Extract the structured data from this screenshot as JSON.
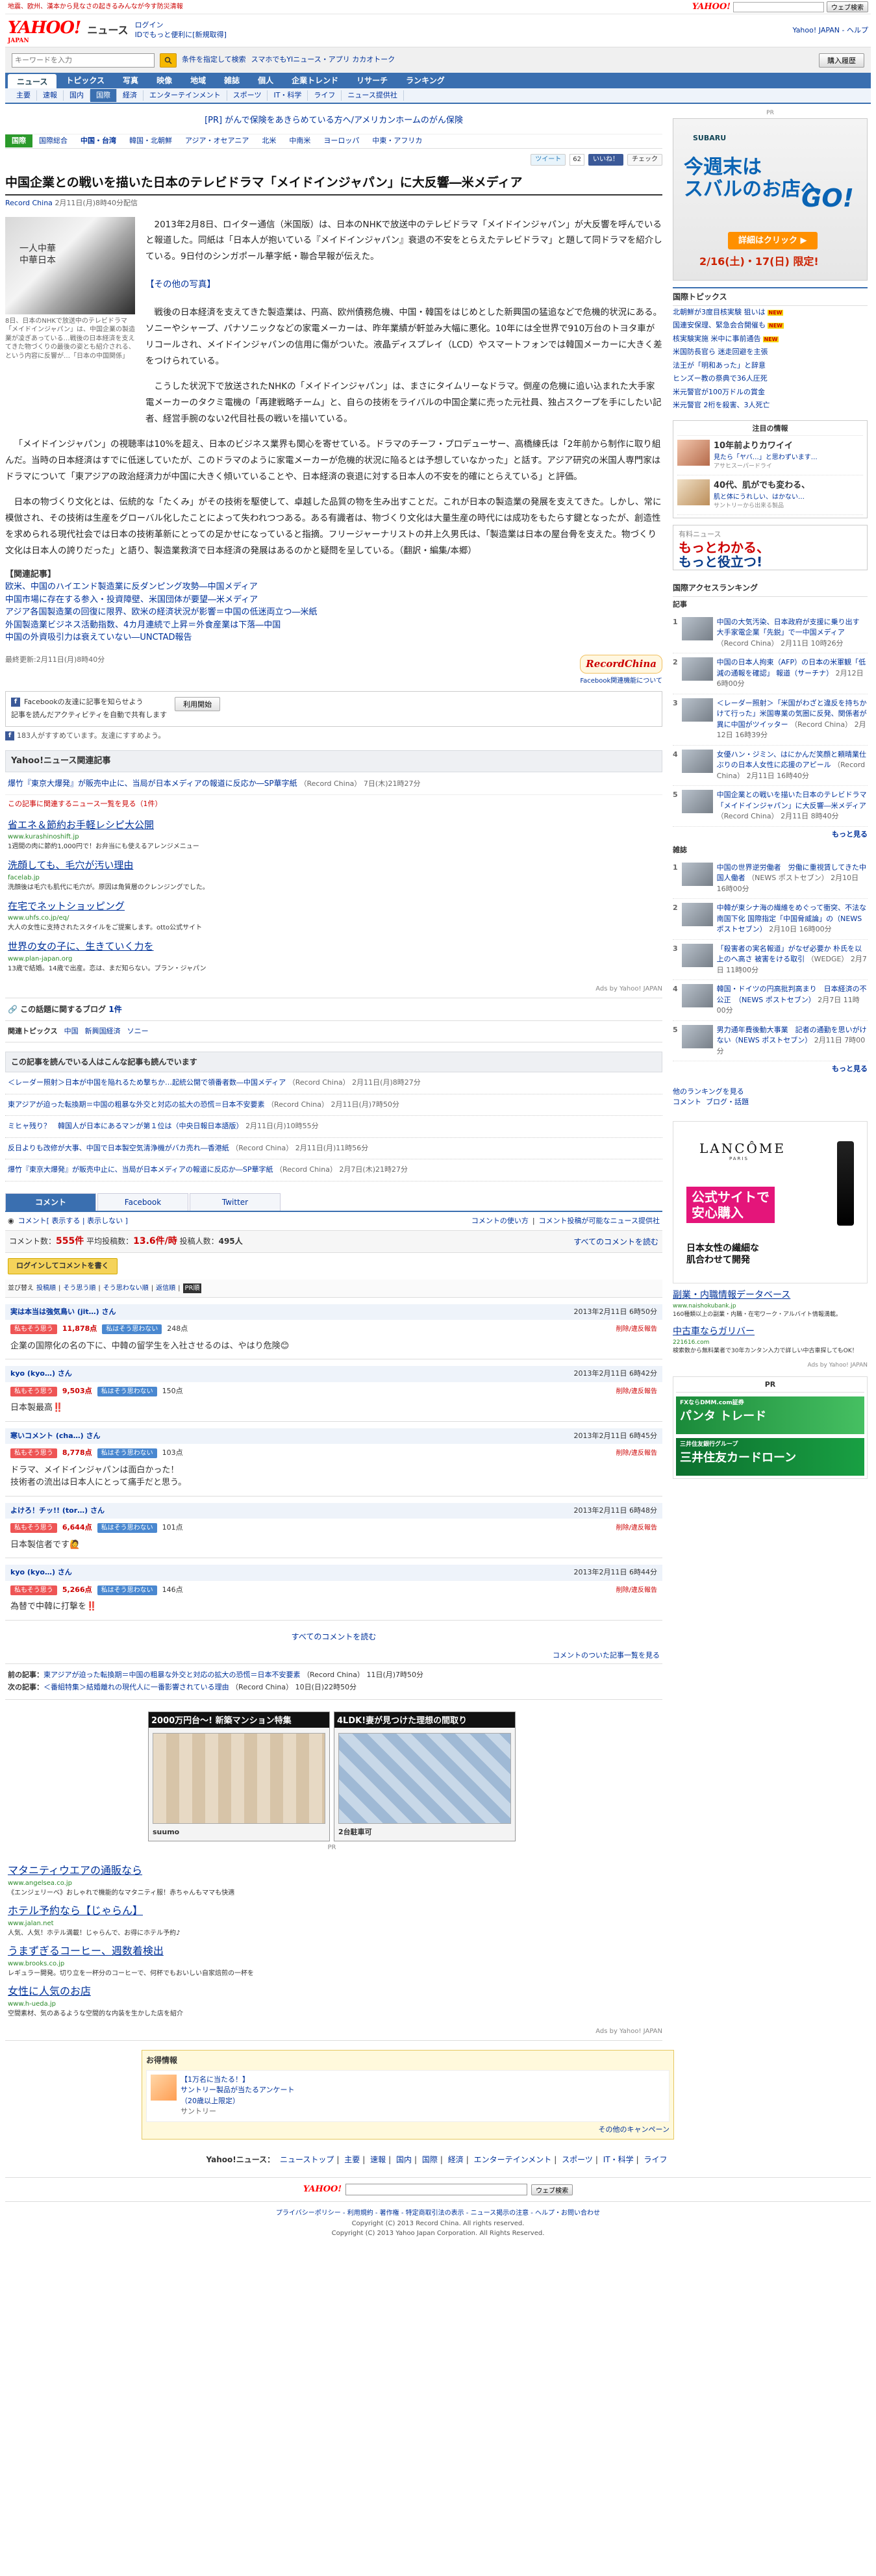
{
  "topstrip": {
    "notice": "地震、欧州、漢本から見なさの起きるみんなが今す防災清報",
    "search_button": "ウェブ検索",
    "yahoo_logo": "YAHOO!"
  },
  "header": {
    "logo": "YAHOO!",
    "logo_sub": "JAPAN",
    "section": "ニュース",
    "login": "ログイン",
    "login_sub": "IDでもっと便利に[新規取得]",
    "right_links": "Yahoo! JAPAN - ヘルプ"
  },
  "searchbar": {
    "placeholder": "キーワードを入力",
    "condition": "条件を指定して検索",
    "smartphone": "スマホでもYIニュース・アプリ カカオトーク",
    "right_button": "購入履歴"
  },
  "nav1": [
    "ニュース",
    "トピックス",
    "写真",
    "映像",
    "地域",
    "雑誌",
    "個人",
    "企業トレンド",
    "リサーチ",
    "ランキング"
  ],
  "nav2": [
    "主要",
    "速報",
    "国内",
    "国際",
    "経済",
    "エンターテインメント",
    "スポーツ",
    "IT・科学",
    "ライフ",
    "ニュース提供社"
  ],
  "nav2_active": 3,
  "pr_ad": {
    "label": "[PR]",
    "text": "がんで保険をあきらめている方へ/アメリカンホームのがん保険"
  },
  "nav3": [
    "国際",
    "国際総合",
    "中国・台湾",
    "韓国・北朝鮮",
    "アジア・オセアニア",
    "北米",
    "中南米",
    "ヨーロッパ",
    "中東・アフリカ"
  ],
  "social": {
    "tweet": "ツイート",
    "tweet_count": "62",
    "like": "いいね！",
    "check": "チェック"
  },
  "article": {
    "title": "中国企業との戦いを描いた日本のテレビドラマ「メイドインジャパン」に大反響―米メディア",
    "source": "Record China",
    "date": "2月11日(月)8時40分配信",
    "photo_text": "一人中華\n中華日本",
    "photo_caption": "8日、日本のNHKで放送中のテレビドラマ「メイドインジャパン」は、中国企業の製造業が凌ぎあっている…戦後の日本経済を支えてきた物づくりの最後の姿とも紹介される、という内容に反響が…「日本の中国関係」",
    "p1": "2013年2月8日、ロイター通信（米国版）は、日本のNHKで放送中のテレビドラマ「メイドインジャパン」が大反響を呼んでいると報道した。同紙は「日本人が抱いている『メイドインジャパン』衰退の不安をとらえたテレビドラマ」と題して同ドラマを紹介している。9日付のシンガポール華字紙・聯合早報が伝えた。",
    "other_photo": "【その他の写真】",
    "p2": "戦後の日本経済を支えてきた製造業は、円高、欧州債務危機、中国・韓国をはじめとした新興国の猛追などで危機的状況にある。ソニーやシャープ、パナソニックなどの家電メーカーは、昨年業績が軒並み大幅に悪化。10年には全世界で910万台のトヨタ車がリコールされ、メイドインジャパンの信用に傷がついた。液晶ディスプレイ（LCD）やスマートフォンでは韓国メーカーに大きく差をつけられている。",
    "p3": "こうした状況下で放送されたNHKの「メイドインジャパン」は、まさにタイムリーなドラマ。倒産の危機に追い込まれた大手家電メーカーのタクミ電機の「再建戦略チーム」と、自らの技術をライバルの中国企業に売った元社員、独占スクープを手にしたい記者、経営手腕のない2代目社長の戦いを描いている。",
    "p4": "「メイドインジャパン」の視聴率は10%を超え、日本のビジネス業界も関心を寄せている。ドラマのチーフ・プロデューサー、高橋練氏は「2年前から制作に取り組んだ。当時の日本経済はすでに低迷していたが、このドラマのように家電メーカーが危機的状況に陥るとは予想していなかった」と話す。アジア研究の米国人専門家はドラマについて「東アジアの政治経済力が中国に大きく傾いていることや、日本経済の衰退に対する日本人の不安を的確にとらえている」と評価。",
    "p5": "日本の物づくり文化とは、伝統的な「たくみ」がその技術を駆使して、卓越した品質の物を生み出すことだ。これが日本の製造業の発展を支えてきた。しかし、常に模倣され、その技術は生産をグローバル化したことによって失われつつある。ある有識者は、物づくり文化は大量生産の時代には成功をもたらす鍵となったが、創造性を求められる現代社会では日本の技術革新にとっての足かせになっていると指摘。フリージャーナリストの井上久男氏は、「製造業は日本の屋台骨を支えた。物づくり文化は日本人の誇りだった」と語り、製造業救済で日本経済の発展はあるのかと疑問を呈している。（翻訳・編集/本郷）",
    "related_title": "【関連記事】",
    "related": [
      "欧米、中国のハイエンド製造業に反ダンピング攻勢―中国メディア",
      "中国市場に存在する参入・投資障壁、米国団体が要望―米メディア",
      "アジア各国製造業の回復に限界、欧米の経済状況が影響＝中国の低迷両立つ―米紙",
      "外国製造業ビジネス活動指数、4カ月連続で上昇＝外食産業は下落―中国",
      "中国の外資吸引力は衰えていない―UNCTAD報告"
    ],
    "updated": "最終更新:2月11日(月)8時40分",
    "rc_logo": "RecordChina",
    "fb_link": "Facebook関連機能について"
  },
  "fb": {
    "title": "Facebookの友達に記事を知らせよう",
    "desc": "記事を読んだアクティビティを自動で共有します",
    "button": "利用開始",
    "note": "183人がすすめています。友達にすすめよう。"
  },
  "yahoo_related": {
    "title": "Yahoo!ニュース関連記事",
    "item": "爆竹『東京大爆発』が販売中止に、当局が日本メディアの報道に反応か―SP華字紙",
    "item_meta": "（Record China） 7日(木)21時27分",
    "tiny": "この記事に関連するニュース一覧を見る（1件）"
  },
  "ads1": [
    {
      "h": "省エネ＆節約お手軽レシピ大公開",
      "u": "www.kurashinoshift.jp",
      "d": "1週間の肉に節約1,000円で！お弁当にも使えるアレンジメニュー"
    },
    {
      "h": "洗顔しても、毛穴が汚い理由",
      "u": "facelab.jp",
      "d": "洗顔後は毛穴も肌代に毛穴が。原因は角質層のクレンジングでした。"
    },
    {
      "h": "在宅でネットショッピング",
      "u": "www.uhfs.co.jp/eq/",
      "d": "大人の女性に支持されたスタイルをご提案します。otto公式サイト"
    },
    {
      "h": "世界の女の子に、生きていく力を",
      "u": "www.plan-japan.org",
      "d": "13歳で結婚。14歳で出産。恋は、まだ知らない。プラン・ジャパン"
    }
  ],
  "ads_label": "Ads by Yahoo! JAPAN",
  "blog": {
    "label": "この話題に関するブログ",
    "count": "1件"
  },
  "tags": {
    "label": "関連トピックス",
    "items": [
      "中国",
      "新興国経済",
      "ソニー"
    ]
  },
  "reads": {
    "title": "この記事を読んでいる人はこんな記事も読んでいます",
    "items": [
      {
        "t": "＜レーダー照射＞日本が中国を陥れるため撃ちか…起統公開で領番者数―中国メディア",
        "m": "（Record China） 2月11日(月)8時27分"
      },
      {
        "t": "東アジアが迫った転換期＝中国の粗暴な外交と対応の拡大の恐慌＝日本不安要素",
        "m": "（Record China） 2月11日(月)7時50分"
      },
      {
        "t": "ミヒャ残り？　韓国人が日本にあるマンが第１位は（中央日報日本語版）",
        "m": "2月11日(月)10時55分"
      },
      {
        "t": "反日よりも改修が大事、中国で日本製空気清浄機がバカ売れ―香港紙",
        "m": "（Record China） 2月11日(月)11時56分"
      },
      {
        "t": "爆竹『東京大爆発』が販売中止に、当局が日本メディアの報道に反応か―SP華字紙",
        "m": "（Record China） 2月7日(木)21時27分"
      }
    ]
  },
  "comments": {
    "tabs": [
      "コメント",
      "Facebook",
      "Twitter"
    ],
    "bar_left": "コメント[ 表示する | 表示しない ]",
    "bar_right1": "コメントの使い方",
    "bar_right2": "コメント投稿が可能なニュース提供社",
    "count_label": "コメント数：",
    "count": "555件",
    "avg_label": "平均投稿数：",
    "avg": "13.6件/時",
    "users_label": "投稿人数：",
    "users": "495人",
    "all_link": "すべてのコメントを読む",
    "post_button": "ログインしてコメントを書く",
    "sort": [
      "並び替え",
      "投稿順",
      "そう思う順",
      "そう思わない順",
      "返信順",
      "PR順"
    ],
    "sort_active": 5,
    "items": [
      {
        "user": "実は本当は強気鳥い (jit…) さん",
        "date": "2013年2月11日 6時50分",
        "agree": "11,878点",
        "disagree": "248点",
        "text": "企業の国際化の名の下に、中韓の留学生を入社させるのは、やはり危険😊"
      },
      {
        "user": "kyo (kyo…) さん",
        "date": "2013年2月11日 6時42分",
        "agree": "9,503点",
        "disagree": "150点",
        "text": "日本製最高‼️"
      },
      {
        "user": "寒いコメント (cha…) さん",
        "date": "2013年2月11日 6時45分",
        "agree": "8,778点",
        "disagree": "103点",
        "text": "ドラマ、メイドインジャパンは面白かった！\n技術者の流出は日本人にとって痛手だと思う。"
      },
      {
        "user": "よけろ！チッ!! (tor…) さん",
        "date": "2013年2月11日 6時48分",
        "agree": "6,644点",
        "disagree": "101点",
        "text": "日本製信者です🙋"
      },
      {
        "user": "kyo (kyo…) さん",
        "date": "2013年2月11日 6時44分",
        "agree": "5,266点",
        "disagree": "146点",
        "text": "為替で中韓に打撃を‼️"
      }
    ],
    "agree_label": "私もそう思う",
    "disagree_label": "私はそう思わない",
    "report": "削除/違反報告",
    "all_bottom": "すべてのコメントを読む",
    "more": "コメントのついた記事一覧を見る"
  },
  "prevnext": {
    "prev_label": "前の記事：",
    "prev": "東アジアが迫った転換期＝中国の粗暴な外交と対応の拡大の恐慌＝日本不安要素",
    "prev_meta": "（Record China） 11日(月)7時50分",
    "next_label": "次の記事：",
    "next": "＜番組特集＞結婚離れの現代人に一番影響されている理由",
    "next_meta": "（Record China） 10日(日)22時50分"
  },
  "bigad": {
    "b1": "2000万円台～! 新築マンション特集",
    "b1f": "suumo",
    "b2": "4LDK!妻が見つけた理想の間取り",
    "b2f": "2台駐車可",
    "label": "PR"
  },
  "ads2": [
    {
      "h": "マタニティウエアの通販なら",
      "u": "www.angelsea.co.jp",
      "d": "《エンジェリーベ》おしゃれで機能的なマタニティ服！赤ちゃんもママも快適"
    },
    {
      "h": "ホテル予約なら【じゃらん】",
      "u": "www.jalan.net",
      "d": "人気、人気！ホテル満載！じゃらんで、お得にホテル予約♪"
    },
    {
      "h": "うまずぎるコーヒー、週数着検出",
      "u": "www.brooks.co.jp",
      "d": "レギュラー開発。切り立を一杯分のコーヒーで、何杯でもおいしい自家焙煎の一杯を"
    },
    {
      "h": "女性に人気のお店",
      "u": "www.h-ueda.jp",
      "d": "空間素材、気のあるような空間的な内装を生かした店を紹介"
    }
  ],
  "info": {
    "title": "お得情報",
    "item1": "【1万名に当たる！】",
    "item2": "サントリー製品が当たるアンケート",
    "item3": "（20歳以上限定）",
    "sponsor": "サントリー",
    "more": "その他のキャンペーン"
  },
  "footnav": [
    "Yahoo!ニュース：",
    "ニューストップ",
    "主要",
    "速報",
    "国内",
    "国際",
    "経済",
    "エンターテインメント",
    "スポーツ",
    "IT・科学",
    "ライフ"
  ],
  "footsearch": {
    "button": "ウェブ検索",
    "yahoo_logo": "YAHOO!"
  },
  "footlinks": "プライバシーポリシー - 利用規約 - 著作権 - 特定商取引法の表示 - ニュース掲示の注意 - ヘルプ・お問い合わせ",
  "copyright1": "Copyright (C) 2013 Record China. All rights reserved.",
  "copyright2": "Copyright (C) 2013 Yahoo Japan Corporation. All Rights Reserved.",
  "right": {
    "pr_label": "PR",
    "subaru": {
      "logo": "SUBARU",
      "big": "今週末は\nスバルのお店へ",
      "go": "GO!",
      "btn": "詳細はクリック ▶",
      "date": "2/16(土)・17(日) 限定!"
    },
    "topics_title": "国際トピックス",
    "topics": [
      {
        "t": "北朝鮮が3度目核実験 狙いは",
        "new": true
      },
      {
        "t": "国連安保理、緊急会合開催も",
        "new": true
      },
      {
        "t": "核実験実施 米中に事前通告",
        "new": true
      },
      {
        "t": "米国防長官ら 迷走回避を主張",
        "new": false
      },
      {
        "t": "法王が「明和あった」と辞意",
        "new": false
      },
      {
        "t": "ヒンズー教の祭典で36人圧死",
        "new": false
      },
      {
        "t": "米元警官が100万ドルの賞金",
        "new": false
      },
      {
        "t": "米元警官 2桁を殺害、3人死亡",
        "new": false
      }
    ],
    "attn_title": "注目の情報",
    "attn": [
      {
        "t": "10年前よりカワイイ",
        "s": "見たら「ヤバ…」と思わずいます…",
        "x": "アサヒスーパードライ"
      },
      {
        "t": "40代、肌がでも変わる、",
        "s": "肌と体にうれしい、はかない…",
        "x": "サントリーから出来る製品"
      }
    ],
    "yuryo": {
      "t1": "有料ニュース",
      "t2": "もっとわかる、",
      "t3": "もっと役立つ!"
    },
    "rank_title": "国際アクセスランキング",
    "rank_sub": "記事",
    "rank": [
      {
        "n": "1",
        "t": "中国の大気汚染、日本政府が支援に乗り出す 大手家電企業「先鋭」で一中国メディア",
        "m": "（Record China） 2月11日 10時26分"
      },
      {
        "n": "2",
        "t": "中国の日本人拘束（AFP）の日本の米軍観「低減の通報を確認」 報道（サーチナ）",
        "m": "2月12日 6時00分"
      },
      {
        "n": "3",
        "t": "＜レーダー照射＞「米国がわざと違反を持ちかけて行った」米国専業の気圏に反発、関係者が異に中国がツイッター",
        "m": "（Record China） 2月12日 16時39分"
      },
      {
        "n": "4",
        "t": "女優ハン・ジミン、はにかんだ笑顔と頼晴業仕ぶりの日本人女性に応援のアピール",
        "m": "（Record China） 2月11日 16時40分"
      },
      {
        "n": "5",
        "t": "中国企業との戦いを描いた日本のテレビドラマ「メイドインジャパン」に大反響―米メディア",
        "m": "（Record China） 2月11日 8時40分"
      }
    ],
    "rank_more": "もっと見る",
    "mag_title": "雑誌",
    "mag": [
      {
        "n": "1",
        "t": "中国の世界逆労働者　労働に重視賃してきた中国人働者",
        "m": "（NEWS ポストセブン） 2月10日 16時00分"
      },
      {
        "n": "2",
        "t": "中韓が東シナ海の繊維をめぐって衝突、不法な南国下化 国際指定「中国脅威論」の（NEWS ポストセブン）",
        "m": "2月10日 16時00分"
      },
      {
        "n": "3",
        "t": "「殺害者の実名報道」がなぜ必要か 朴氏を以上のへ高さ 被害をける取引",
        "m": "（WEDGE） 2月7日 11時00分"
      },
      {
        "n": "4",
        "t": "韓国・ドイツの円高批判高まり　日本経済の不公正　（NEWS ポストセブン）",
        "m": "2月7日 11時00分"
      },
      {
        "n": "5",
        "t": "男力通年費後動大事業　記者の通勤を思いがけない（NEWS ポストセブン）",
        "m": "2月11日 7時00分"
      }
    ],
    "mag_more": "もっと見る",
    "mag_links": "他のランキングを見る\nコメント  ブログ・話題",
    "lancome": {
      "brand": "LANCÔME",
      "paris": "PARIS",
      "tag": "公式サイトで\n安心購入",
      "sub": "日本女性の繊細な\n肌合わせて開発"
    },
    "rlinks": [
      {
        "h": "副業・内職情報データベース",
        "u": "www.naishokubank.jp",
        "d": "160種類以上の副業・内職・在宅ワーク・アルバイト情報満載。"
      },
      {
        "h": "中古車ならガリバー",
        "u": "221616.com",
        "d": "検索数から無料業者で30年カンタン入力で詳しい中古車探してもOK！"
      }
    ],
    "rlinks_foot": "Ads by Yahoo! JAPAN",
    "pr2_title": "PR",
    "pban1": {
      "small": "FXならDMM.com証券",
      "large": "パンタ トレード"
    },
    "pban2": {
      "small": "三井住友銀行グループ",
      "large": "三井住友カードローン"
    }
  }
}
